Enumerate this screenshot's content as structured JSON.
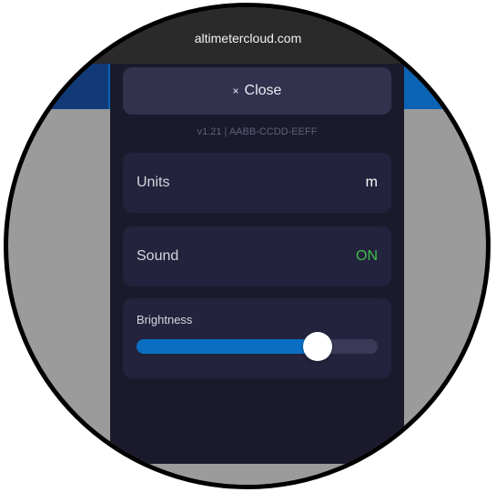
{
  "browser": {
    "url": "altimetercloud.com"
  },
  "menu": {
    "close_icon": "×",
    "close_label": "Close",
    "version": "v1.21 | AABB-CCDD-EEFF",
    "units": {
      "label": "Units",
      "value": "m"
    },
    "sound": {
      "label": "Sound",
      "value": "ON"
    },
    "brightness": {
      "label": "Brightness",
      "level_fraction": 0.75
    }
  },
  "colors": {
    "panel": "#1a1a2c",
    "card": "#23233d",
    "accent": "#0a6fc2",
    "on_green": "#3fbd4b"
  }
}
